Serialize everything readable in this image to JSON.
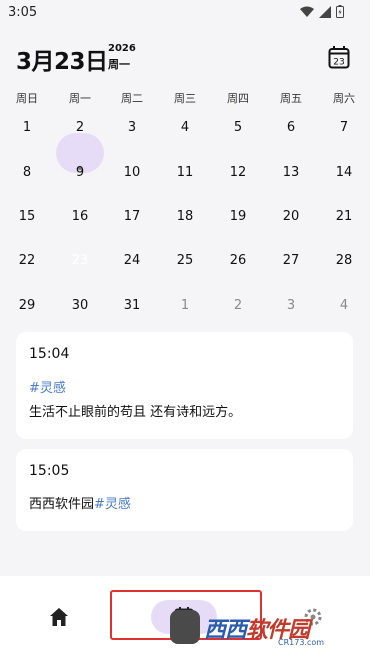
{
  "status": {
    "time": "3:05"
  },
  "header": {
    "date": "3月23日",
    "year": "2026",
    "weekday": "周一",
    "calendar_button_day": "23"
  },
  "weekdays": [
    "周日",
    "周一",
    "周二",
    "周三",
    "周四",
    "周五",
    "周六"
  ],
  "calendar": {
    "rows": [
      [
        "1",
        "2",
        "3",
        "4",
        "5",
        "6",
        "7"
      ],
      [
        "8",
        "9",
        "10",
        "11",
        "12",
        "13",
        "14"
      ],
      [
        "15",
        "16",
        "17",
        "18",
        "19",
        "20",
        "21"
      ],
      [
        "22",
        "23",
        "24",
        "25",
        "26",
        "27",
        "28"
      ],
      [
        "29",
        "30",
        "31",
        "1",
        "2",
        "3",
        "4"
      ]
    ],
    "selected": "23",
    "accent": "#e6dcf7"
  },
  "notes": [
    {
      "time": "15:04",
      "tag": "#灵感",
      "text": "生活不止眼前的苟且 还有诗和远方。"
    },
    {
      "time": "15:05",
      "text": "西西软件园",
      "tag": "#灵感"
    }
  ],
  "nav": {
    "items": [
      "home-icon",
      "calendar-icon",
      "settings-icon"
    ],
    "active": "calendar-icon"
  },
  "watermark": {
    "part1": "西西",
    "part2": "软件园",
    "url": "CR173.com"
  },
  "colors": {
    "tag": "#4a7bc8",
    "highlight_box": "#e03030"
  }
}
